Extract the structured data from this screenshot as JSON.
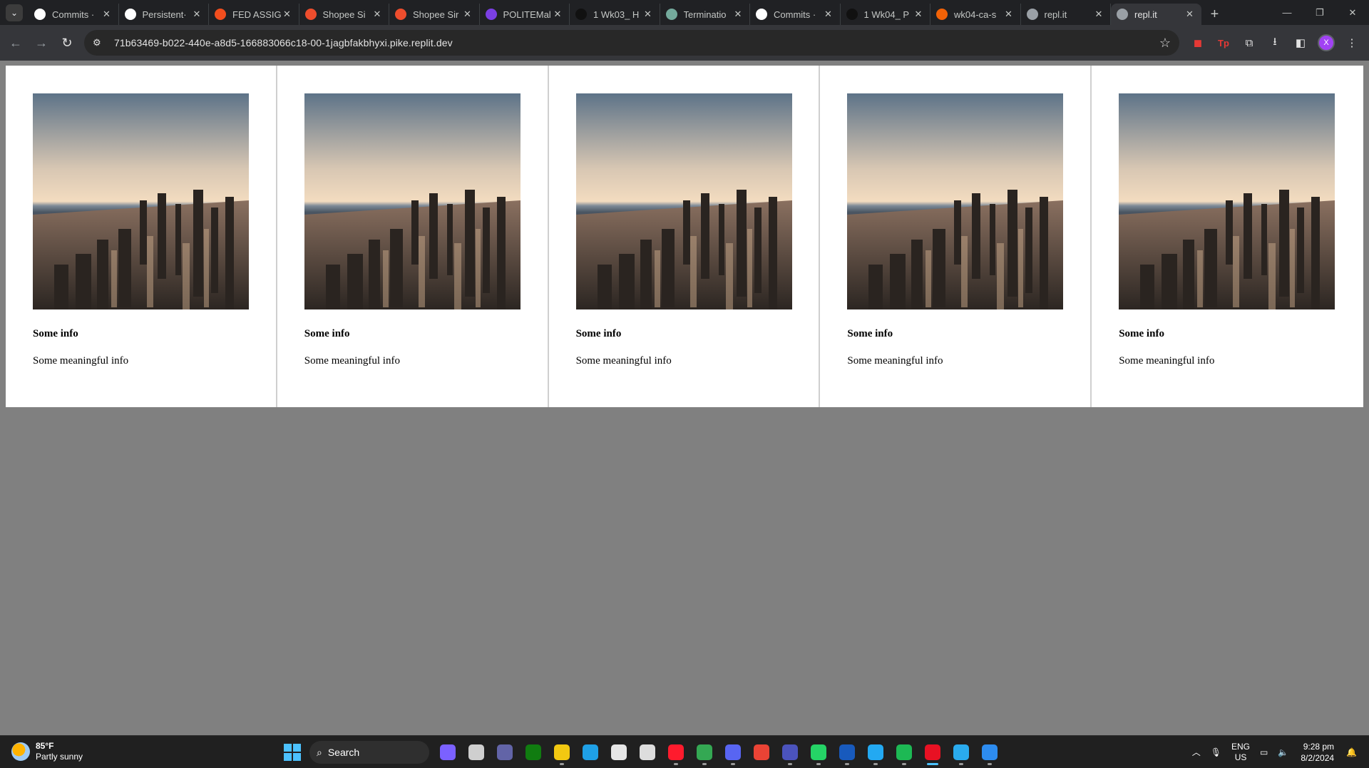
{
  "browser": {
    "tabs": [
      {
        "title": "Commits · ",
        "favicon_color": "#ffffff",
        "favicon_glyph": "github-icon"
      },
      {
        "title": "Persistent·",
        "favicon_color": "#ffffff",
        "favicon_glyph": "github-icon"
      },
      {
        "title": "FED ASSIG",
        "favicon_color": "#f24e1e",
        "favicon_glyph": "figma-icon"
      },
      {
        "title": "Shopee Si",
        "favicon_color": "#ee4d2d",
        "favicon_glyph": "shopee-icon"
      },
      {
        "title": "Shopee Sir",
        "favicon_color": "#ee4d2d",
        "favicon_glyph": "shopee-icon"
      },
      {
        "title": "POLITEMal",
        "favicon_color": "#7b3fe4",
        "favicon_glyph": "politemall-icon"
      },
      {
        "title": "1 Wk03_ H",
        "favicon_color": "#111111",
        "favicon_glyph": "np-icon"
      },
      {
        "title": "Terminatio",
        "favicon_color": "#74aa9c",
        "favicon_glyph": "chatgpt-icon"
      },
      {
        "title": "Commits · ",
        "favicon_color": "#ffffff",
        "favicon_glyph": "github-icon"
      },
      {
        "title": "1 Wk04_ P",
        "favicon_color": "#111111",
        "favicon_glyph": "np-icon"
      },
      {
        "title": "wk04-ca-s",
        "favicon_color": "#f26207",
        "favicon_glyph": "replit-icon"
      },
      {
        "title": "repl.it",
        "favicon_color": "#9aa0a6",
        "favicon_glyph": "globe-icon"
      },
      {
        "title": "repl.it",
        "favicon_color": "#9aa0a6",
        "favicon_glyph": "globe-icon"
      }
    ],
    "active_tab_index": 12,
    "url": "71b63469-b022-440e-a8d5-166883066c18-00-1jagbfakbhyxi.pike.replit.dev",
    "profile_initial": "X"
  },
  "page": {
    "cards": [
      {
        "title": "Some info",
        "text": "Some meaningful info"
      },
      {
        "title": "Some info",
        "text": "Some meaningful info"
      },
      {
        "title": "Some info",
        "text": "Some meaningful info"
      },
      {
        "title": "Some info",
        "text": "Some meaningful info"
      },
      {
        "title": "Some info",
        "text": "Some meaningful info"
      }
    ]
  },
  "taskbar": {
    "weather_temp": "85°F",
    "weather_desc": "Partly sunny",
    "search_label": "Search",
    "language_top": "ENG",
    "language_bottom": "US",
    "time": "9:28 pm",
    "date": "8/2/2024",
    "apps": [
      {
        "name": "copilot",
        "color": "#7b61ff"
      },
      {
        "name": "task-view",
        "color": "#cfcfcf"
      },
      {
        "name": "zoom",
        "color": "#6264a7"
      },
      {
        "name": "xbox",
        "color": "#107c10"
      },
      {
        "name": "file-explorer",
        "color": "#f2c811"
      },
      {
        "name": "edge",
        "color": "#1fa0e6"
      },
      {
        "name": "store",
        "color": "#e6e6e6"
      },
      {
        "name": "snip",
        "color": "#dddddd"
      },
      {
        "name": "opera",
        "color": "#ff1b2d"
      },
      {
        "name": "chrome",
        "color": "#34a853"
      },
      {
        "name": "discord",
        "color": "#5865f2"
      },
      {
        "name": "gmail-alt",
        "color": "#ea4335"
      },
      {
        "name": "teams",
        "color": "#4b53bc"
      },
      {
        "name": "whatsapp",
        "color": "#25d366"
      },
      {
        "name": "word",
        "color": "#185abd"
      },
      {
        "name": "vscode",
        "color": "#23a9f2"
      },
      {
        "name": "spotify",
        "color": "#1db954"
      },
      {
        "name": "snipping",
        "color": "#e81123"
      },
      {
        "name": "telegram",
        "color": "#2aabee"
      },
      {
        "name": "photos",
        "color": "#2d8cf0"
      }
    ]
  }
}
